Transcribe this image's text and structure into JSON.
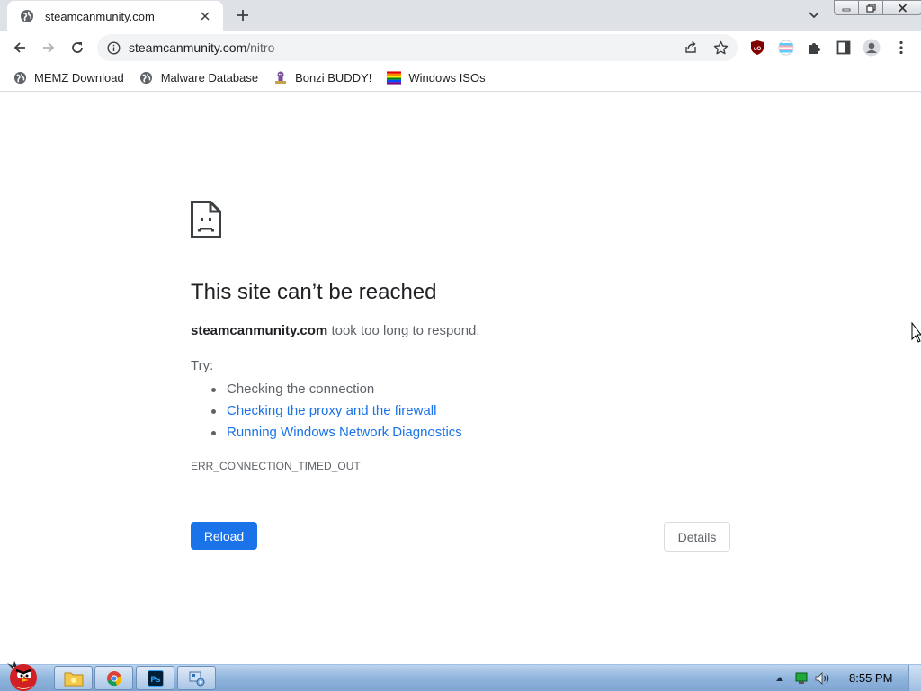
{
  "window": {
    "tab_title": "steamcanmunity.com",
    "minimize_icon": "minimize-icon",
    "restore_icon": "restore-icon",
    "close_icon": "close-icon"
  },
  "toolbar": {
    "url_host": "steamcanmunity.com",
    "url_path": "/nitro"
  },
  "bookmarks": [
    {
      "label": "MEMZ Download",
      "icon": "globe-icon"
    },
    {
      "label": "Malware Database",
      "icon": "globe-icon"
    },
    {
      "label": "Bonzi BUDDY!",
      "icon": "bonzi-icon"
    },
    {
      "label": "Windows ISOs",
      "icon": "rainbow-flag-icon"
    }
  ],
  "error": {
    "title": "This site can’t be reached",
    "host": "steamcanmunity.com",
    "desc_suffix": " took too long to respond.",
    "try_label": "Try:",
    "suggestions": [
      "Checking the connection",
      "Checking the proxy and the firewall",
      "Running Windows Network Diagnostics"
    ],
    "code": "ERR_CONNECTION_TIMED_OUT",
    "reload_label": "Reload",
    "details_label": "Details"
  },
  "taskbar": {
    "clock": "8:55 PM"
  },
  "colors": {
    "accent": "#1a73e8",
    "tab_strip": "#dee1e6",
    "text_secondary": "#5f6368"
  }
}
